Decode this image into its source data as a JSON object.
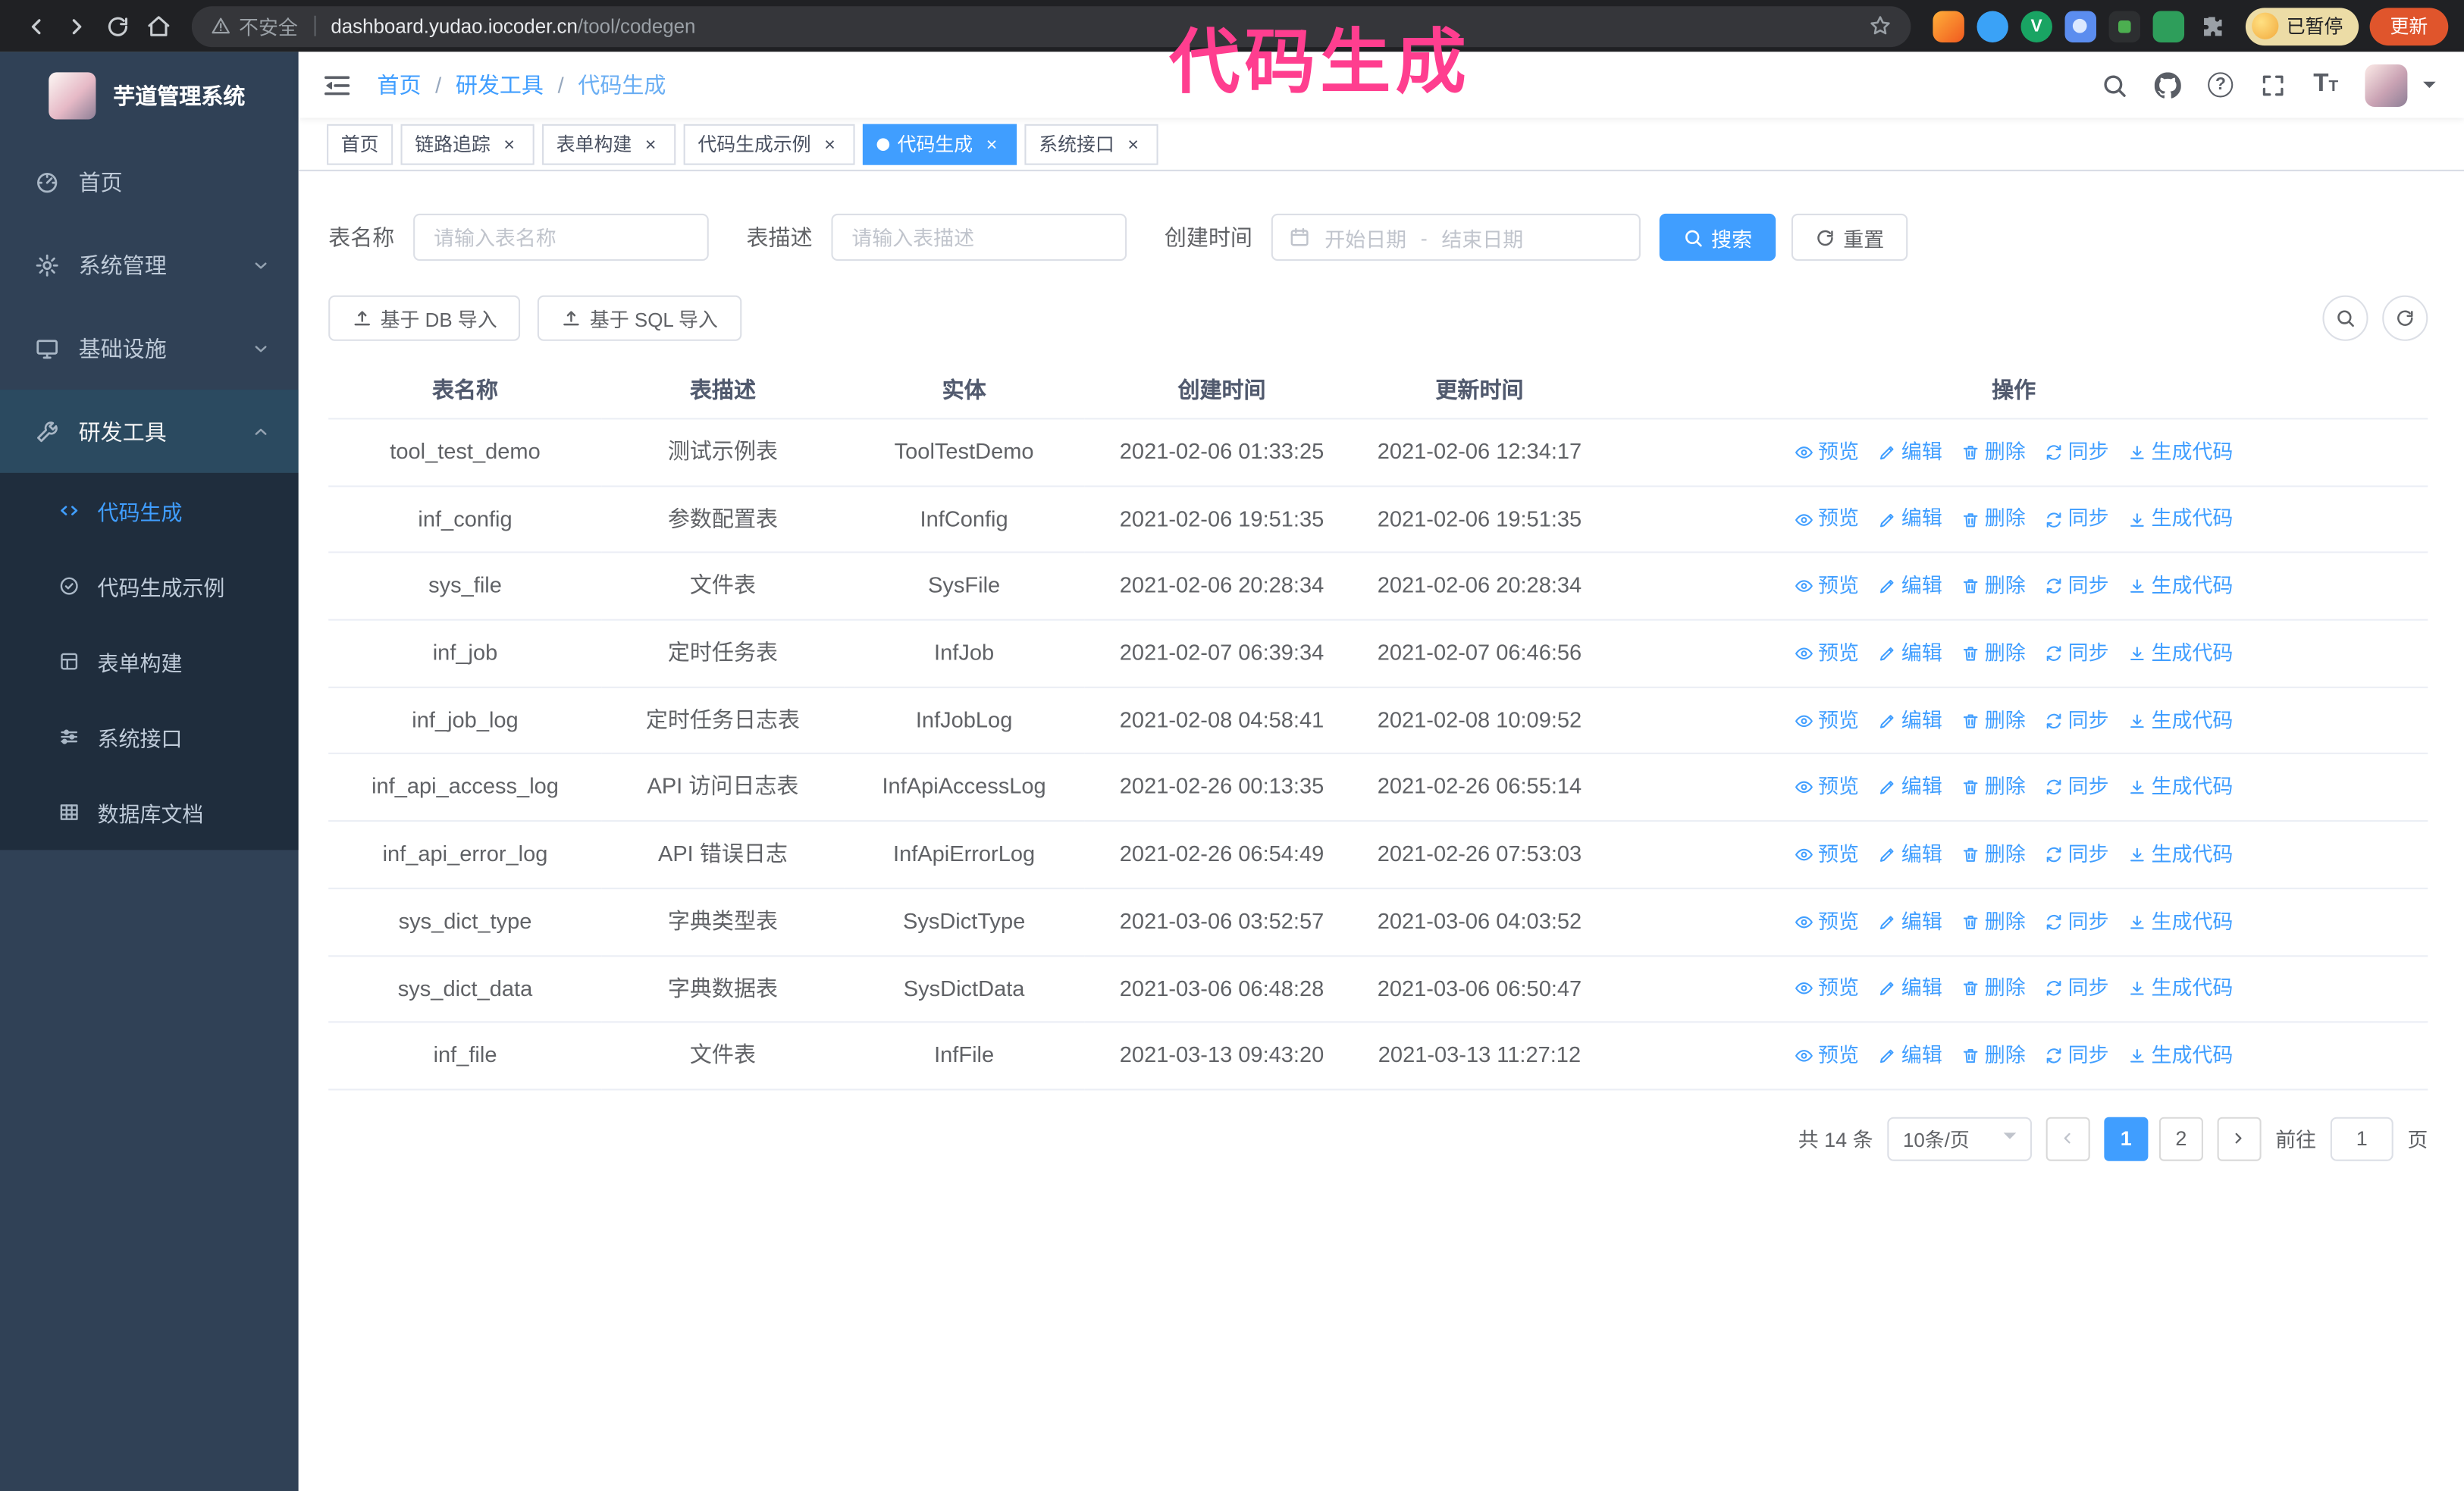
{
  "browser": {
    "security_label": "不安全",
    "url_host": "dashboard.yudao.iocoder.cn",
    "url_path": "/tool/codegen",
    "extensions": [
      "orange-extension-icon",
      "blue-drop-extension-icon",
      "green-check-extension-icon",
      "people-extension-icon",
      "capture-extension-icon",
      "green-extension-icon",
      "puzzle-extensions-icon"
    ],
    "profile_badge": "已暂停",
    "update_button": "更新"
  },
  "annotation": "代码生成",
  "sidebar": {
    "logo_title": "芋道管理系统",
    "items": [
      {
        "label": "首页",
        "icon": "dashboard-icon"
      },
      {
        "label": "系统管理",
        "icon": "gear-icon",
        "chevron": "down"
      },
      {
        "label": "基础设施",
        "icon": "monitor-icon",
        "chevron": "down"
      },
      {
        "label": "研发工具",
        "icon": "tools-icon",
        "chevron": "up",
        "active": true
      }
    ],
    "submenu": [
      {
        "label": "代码生成",
        "icon": "code-icon",
        "active": true
      },
      {
        "label": "代码生成示例",
        "icon": "badge-icon"
      },
      {
        "label": "表单构建",
        "icon": "form-icon"
      },
      {
        "label": "系统接口",
        "icon": "sliders-icon"
      },
      {
        "label": "数据库文档",
        "icon": "table-grid-icon"
      }
    ]
  },
  "breadcrumb": {
    "items": [
      "首页",
      "研发工具",
      "代码生成"
    ],
    "separator": "/"
  },
  "tabs": [
    {
      "label": "首页",
      "closable": false,
      "active": false
    },
    {
      "label": "链路追踪",
      "closable": true,
      "active": false
    },
    {
      "label": "表单构建",
      "closable": true,
      "active": false
    },
    {
      "label": "代码生成示例",
      "closable": true,
      "active": false
    },
    {
      "label": "代码生成",
      "closable": true,
      "active": true
    },
    {
      "label": "系统接口",
      "closable": true,
      "active": false
    }
  ],
  "filters": {
    "table_name_label": "表名称",
    "table_name_placeholder": "请输入表名称",
    "table_desc_label": "表描述",
    "table_desc_placeholder": "请输入表描述",
    "create_time_label": "创建时间",
    "date_start_placeholder": "开始日期",
    "date_separator": "-",
    "date_end_placeholder": "结束日期",
    "search_button": "搜索",
    "reset_button": "重置"
  },
  "toolbar": {
    "import_db": "基于 DB 导入",
    "import_sql": "基于 SQL 导入"
  },
  "table": {
    "columns": [
      "表名称",
      "表描述",
      "实体",
      "创建时间",
      "更新时间",
      "操作"
    ],
    "actions": [
      {
        "name": "preview",
        "label": "预览",
        "icon": "eye-icon"
      },
      {
        "name": "edit",
        "label": "编辑",
        "icon": "pencil-icon"
      },
      {
        "name": "delete",
        "label": "删除",
        "icon": "trash-icon"
      },
      {
        "name": "sync",
        "label": "同步",
        "icon": "sync-icon"
      },
      {
        "name": "generate-code",
        "label": "生成代码",
        "icon": "download-icon"
      }
    ],
    "rows": [
      {
        "name": "tool_test_demo",
        "desc": "测试示例表",
        "entity": "ToolTestDemo",
        "created": "2021-02-06 01:33:25",
        "updated": "2021-02-06 12:34:17"
      },
      {
        "name": "inf_config",
        "desc": "参数配置表",
        "entity": "InfConfig",
        "created": "2021-02-06 19:51:35",
        "updated": "2021-02-06 19:51:35"
      },
      {
        "name": "sys_file",
        "desc": "文件表",
        "entity": "SysFile",
        "created": "2021-02-06 20:28:34",
        "updated": "2021-02-06 20:28:34"
      },
      {
        "name": "inf_job",
        "desc": "定时任务表",
        "entity": "InfJob",
        "created": "2021-02-07 06:39:34",
        "updated": "2021-02-07 06:46:56"
      },
      {
        "name": "inf_job_log",
        "desc": "定时任务日志表",
        "entity": "InfJobLog",
        "created": "2021-02-08 04:58:41",
        "updated": "2021-02-08 10:09:52"
      },
      {
        "name": "inf_api_access_log",
        "desc": "API 访问日志表",
        "entity": "InfApiAccessLog",
        "created": "2021-02-26 00:13:35",
        "updated": "2021-02-26 06:55:14"
      },
      {
        "name": "inf_api_error_log",
        "desc": "API 错误日志",
        "entity": "InfApiErrorLog",
        "created": "2021-02-26 06:54:49",
        "updated": "2021-02-26 07:53:03"
      },
      {
        "name": "sys_dict_type",
        "desc": "字典类型表",
        "entity": "SysDictType",
        "created": "2021-03-06 03:52:57",
        "updated": "2021-03-06 04:03:52"
      },
      {
        "name": "sys_dict_data",
        "desc": "字典数据表",
        "entity": "SysDictData",
        "created": "2021-03-06 06:48:28",
        "updated": "2021-03-06 06:50:47"
      },
      {
        "name": "inf_file",
        "desc": "文件表",
        "entity": "InfFile",
        "created": "2021-03-13 09:43:20",
        "updated": "2021-03-13 11:27:12"
      }
    ]
  },
  "pagination": {
    "total_text": "共 14 条",
    "page_size": "10条/页",
    "pages": [
      "1",
      "2"
    ],
    "active_page": "1",
    "goto_label": "前往",
    "goto_value": "1",
    "goto_suffix": "页"
  },
  "colors": {
    "accent": "#409eff",
    "sidebar_bg": "#304156",
    "sidebar_submenu_bg": "#1f2d3d",
    "annotation": "#ff3e8f",
    "chrome_bg": "#202124",
    "update_button_bg": "#e0552c"
  }
}
